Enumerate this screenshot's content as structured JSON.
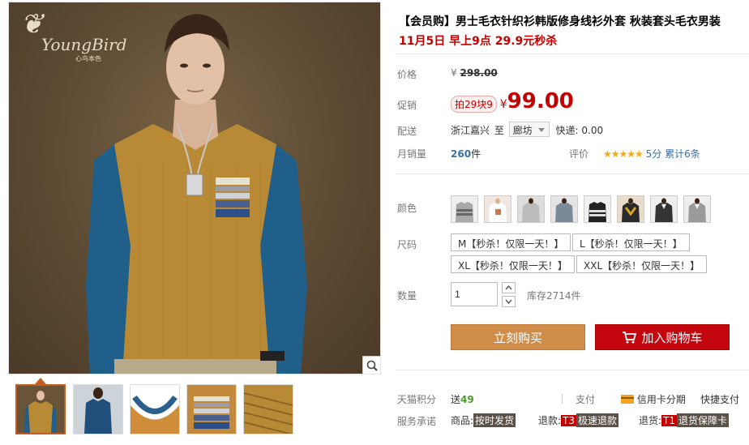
{
  "brand": {
    "logo_text": "YoungBird",
    "logo_sub": "心鸟本色"
  },
  "product": {
    "title": "【会员购】男士毛衣针织衫韩版修身线衫外套 秋装套头毛衣男装",
    "subtitle": "11月5日 早上9点 29.9元秒杀"
  },
  "price": {
    "label": "价格",
    "currency": "¥",
    "original": "298.00"
  },
  "promo": {
    "label": "促销",
    "badge": "拍29块9",
    "currency": "¥",
    "price": "99.00"
  },
  "shipping": {
    "label": "配送",
    "from": "浙江嘉兴",
    "to_word": "至",
    "destination": "廊坊",
    "fee_text": "快递: 0.00"
  },
  "sales": {
    "label": "月销量",
    "count": "260",
    "unit": "件",
    "rating_label": "评价",
    "stars": "★★★★★",
    "score": "5分",
    "review_text": "累计6条"
  },
  "color": {
    "label": "颜色",
    "swatches": [
      "gray-stripe",
      "white-print",
      "gray-sweater",
      "blue-gray",
      "black-stripe",
      "dark-yellow",
      "black-vneck",
      "gray-vneck"
    ]
  },
  "size": {
    "label": "尺码",
    "options": [
      "M【秒杀！仅限一天！】",
      "L【秒杀！仅限一天！】",
      "XL【秒杀！仅限一天！】",
      "XXL【秒杀！仅限一天！】"
    ]
  },
  "quantity": {
    "label": "数量",
    "value": "1",
    "stock": "库存2714件"
  },
  "actions": {
    "buy_now": "立刻购买",
    "add_to_cart": "加入购物车"
  },
  "points": {
    "label": "天猫积分",
    "prefix": "送",
    "value": "49",
    "pay_label": "支付",
    "credit_label": "信用卡分期",
    "quick_pay": "快捷支付"
  },
  "service": {
    "label": "服务承诺",
    "goods_label": "商品:",
    "goods_tag": "按时发货",
    "refund_label": "退款:",
    "refund_code": "T3",
    "refund_tag": "极速退款",
    "return_label": "退货:",
    "return_code": "T1",
    "return_tag": "退货保障卡"
  },
  "colors": {
    "accent_red": "#c40000",
    "buy_orange": "#d08d4a",
    "cart_red": "#c4060e",
    "star_gold": "#f6a80c",
    "sweater_mustard": "#b98a35",
    "sleeve_blue": "#1f5f8a"
  }
}
